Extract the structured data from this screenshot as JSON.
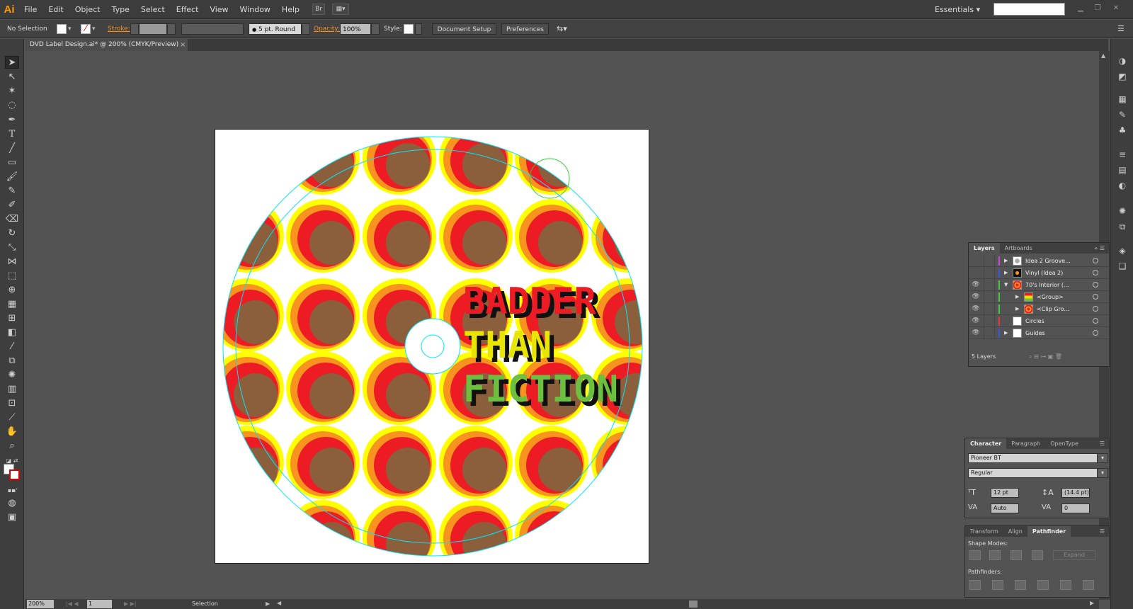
{
  "app": {
    "logo": "Ai"
  },
  "menu": [
    "File",
    "Edit",
    "Object",
    "Type",
    "Select",
    "Effect",
    "View",
    "Window",
    "Help"
  ],
  "menu_icons": {
    "bridge": "Br"
  },
  "workspace": {
    "label": "Essentials",
    "arrow": "▾"
  },
  "control": {
    "selection": "No Selection",
    "stroke_label": "Stroke:",
    "brush": "5 pt. Round",
    "opacity_label": "Opacity:",
    "opacity_value": "100%",
    "style_label": "Style:",
    "doc_setup": "Document Setup",
    "preferences": "Preferences"
  },
  "document": {
    "tab": "DVD Label Design.ai* @ 200% (CMYK/Preview)",
    "close": "×"
  },
  "artwork": {
    "title_lines": [
      "BADDER",
      "THAN",
      "FICTION"
    ],
    "colors": {
      "yellow": "#ffff00",
      "orange": "#f7931e",
      "red": "#ed1c24",
      "brown": "#8b5e3c",
      "title1": "#ed1c24",
      "title2": "#e8e600",
      "title3": "#6cbf3f"
    }
  },
  "layers_panel": {
    "tabs": [
      "Layers",
      "Artboards"
    ],
    "rows": [
      {
        "name": "Idea 2 Groove...",
        "color": "#c64bd4",
        "visible": false,
        "expanded": false,
        "indent": 0
      },
      {
        "name": "Vinyl (Idea 2)",
        "color": "#3b55d9",
        "visible": false,
        "expanded": false,
        "indent": 0
      },
      {
        "name": "70's Interior (...",
        "color": "#3fcc45",
        "visible": true,
        "expanded": true,
        "indent": 0
      },
      {
        "name": "<Group>",
        "color": "#3fcc45",
        "visible": true,
        "expanded": false,
        "indent": 1
      },
      {
        "name": "<Clip Gro...",
        "color": "#3fcc45",
        "visible": true,
        "expanded": false,
        "indent": 1
      },
      {
        "name": "Circles",
        "color": "#e03b3b",
        "visible": true,
        "expanded": null,
        "indent": 0
      },
      {
        "name": "Guides",
        "color": "#3b55d9",
        "visible": true,
        "expanded": false,
        "indent": 0
      }
    ],
    "count": "5 Layers"
  },
  "character_panel": {
    "tabs": [
      "Character",
      "Paragraph",
      "OpenType"
    ],
    "font": "Pioneer BT",
    "style": "Regular",
    "size": "12 pt",
    "leading": "(14.4 pt)",
    "kerning": "Auto",
    "tracking": "0"
  },
  "pathfinder_panel": {
    "tabs": [
      "Transform",
      "Align",
      "Pathfinder"
    ],
    "shape_modes": "Shape Modes:",
    "expand": "Expand",
    "pathfinders": "Pathfinders:"
  },
  "status": {
    "zoom": "200%",
    "page": "1",
    "tool": "Selection"
  }
}
